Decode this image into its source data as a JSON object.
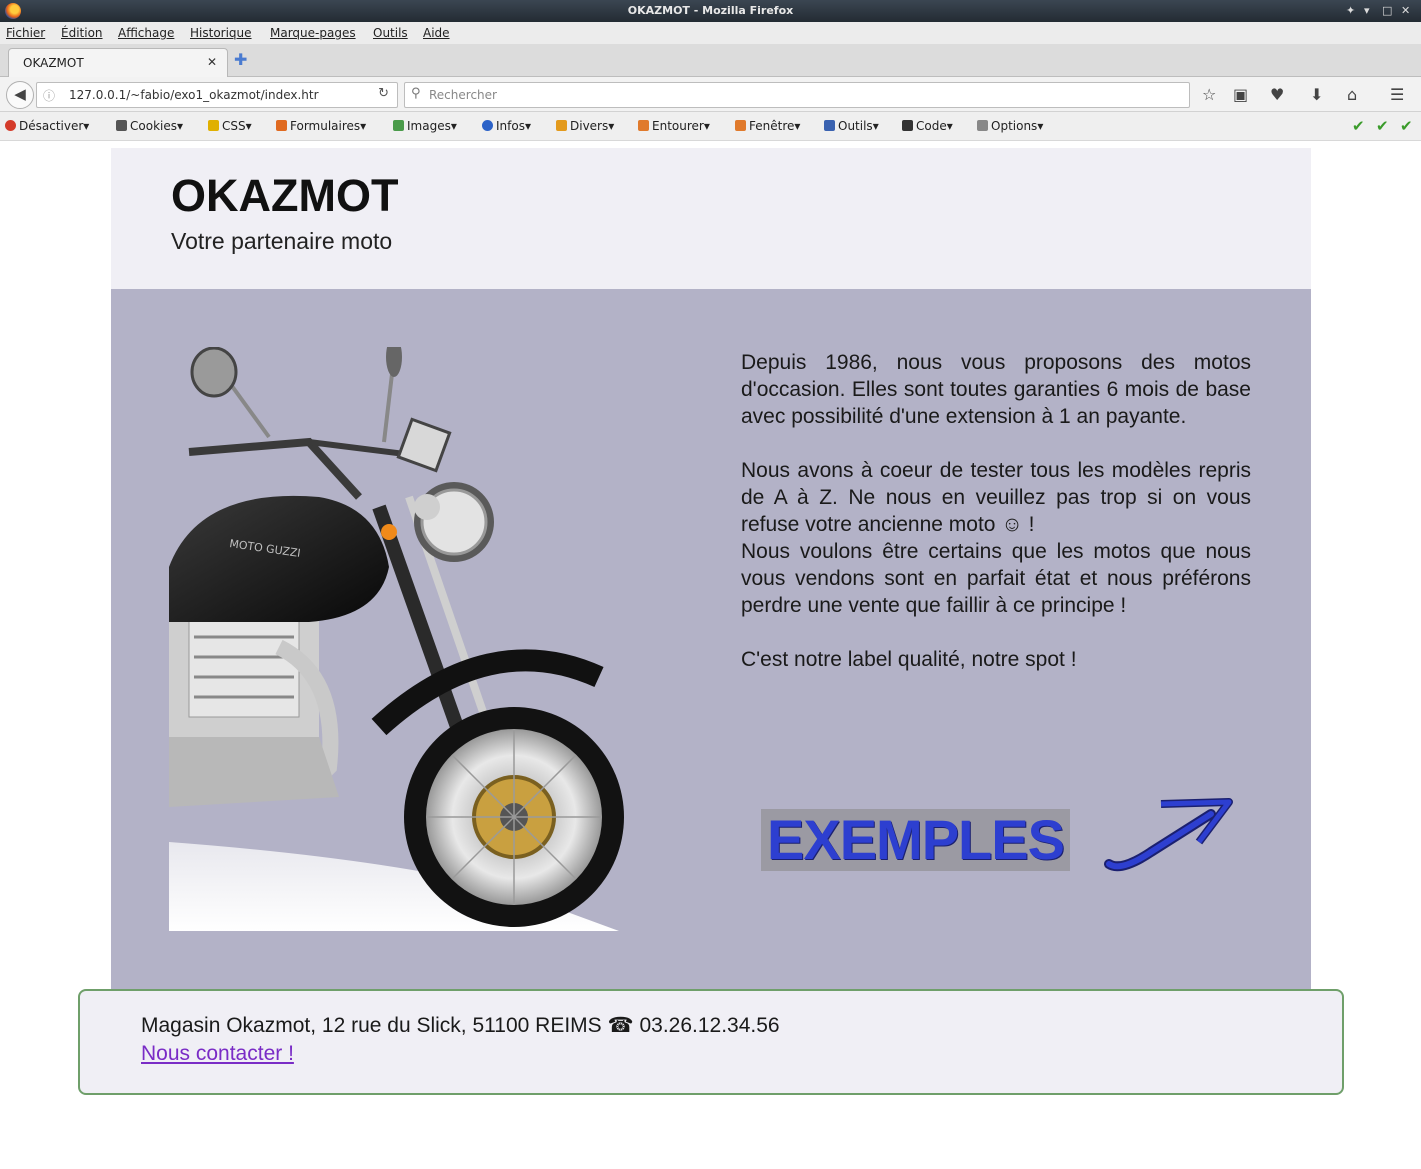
{
  "window": {
    "title": "OKAZMOT - Mozilla Firefox"
  },
  "menu": [
    "Fichier",
    "Édition",
    "Affichage",
    "Historique",
    "Marque-pages",
    "Outils",
    "Aide"
  ],
  "tab": {
    "label": "OKAZMOT"
  },
  "address": {
    "url": "127.0.0.1/~fabio/exo1_okazmot/index.htr"
  },
  "search": {
    "placeholder": "Rechercher"
  },
  "devtoolbar": [
    "Désactiver",
    "Cookies",
    "CSS",
    "Formulaires",
    "Images",
    "Infos",
    "Divers",
    "Entourer",
    "Fenêtre",
    "Outils",
    "Code",
    "Options"
  ],
  "site": {
    "logo": "OKAZMOT",
    "tagline": "Votre partenaire moto",
    "para1": "Depuis 1986, nous vous proposons des motos d'occasion. Elles sont toutes garanties 6 mois de base avec possibilité d'une extension à 1 an payante.",
    "para2": "Nous avons à coeur de tester tous les modèles repris de A à Z. Ne nous en veuillez pas trop si on vous refuse votre ancienne moto ☺ !",
    "para3": "Nous voulons être certains que les motos que nous vous vendons sont en parfait état et nous préférons perdre une vente que faillir à ce principe !",
    "para4": "C'est notre label qualité, notre spot !",
    "exemples": "EXEMPLES",
    "address": "Magasin Okazmot, 12 rue du Slick, 51100 REIMS ☎ 03.26.12.34.56",
    "contact": "Nous contacter !"
  },
  "colors": {
    "header_bg": "#f0eff5",
    "main_bg": "#b3b2c7",
    "link": "#7a2cc6",
    "exemples_text": "#2d3fd0",
    "footer_border": "#6f9f6a"
  }
}
